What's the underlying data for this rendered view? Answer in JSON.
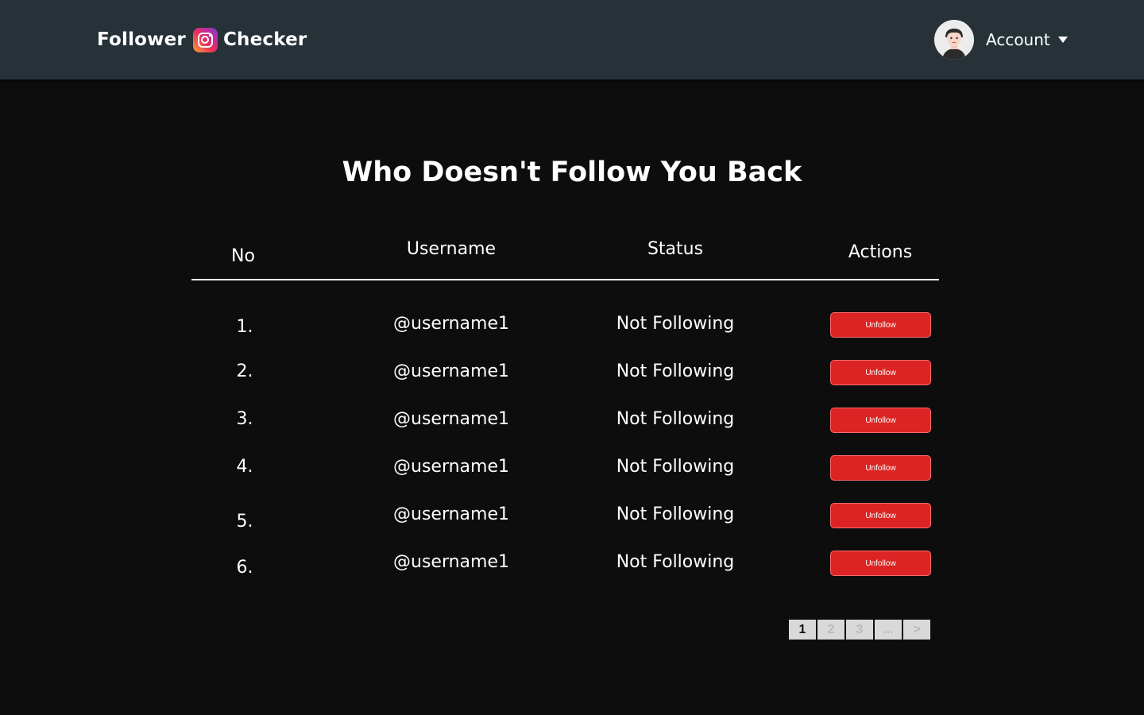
{
  "header": {
    "brand_left": "Follower",
    "brand_right": "Checker",
    "account_label": "Account"
  },
  "page": {
    "title": "Who Doesn't Follow You Back"
  },
  "table": {
    "columns": [
      "No",
      "Username",
      "Status",
      "Actions"
    ],
    "rows": [
      {
        "no": "1.",
        "username": "@username1",
        "status": "Not Following",
        "action": "Unfollow"
      },
      {
        "no": "2.",
        "username": "@username1",
        "status": "Not Following",
        "action": "Unfollow"
      },
      {
        "no": "3.",
        "username": "@username1",
        "status": "Not Following",
        "action": "Unfollow"
      },
      {
        "no": "4.",
        "username": "@username1",
        "status": "Not Following",
        "action": "Unfollow"
      },
      {
        "no": "5.",
        "username": "@username1",
        "status": "Not Following",
        "action": "Unfollow"
      },
      {
        "no": "6.",
        "username": "@username1",
        "status": "Not Following",
        "action": "Unfollow"
      }
    ]
  },
  "pagination": {
    "pages": [
      "1",
      "2",
      "3",
      "...",
      ">"
    ],
    "current": "1"
  },
  "colors": {
    "header_bg": "#263238",
    "page_bg": "#0d0d0d",
    "unfollow_button": "#dc2424",
    "pager_bg": "#d9d9d9"
  },
  "icons": {
    "brand_logo": "instagram-icon",
    "account_avatar": "avatar",
    "dropdown": "chevron-down-icon"
  }
}
